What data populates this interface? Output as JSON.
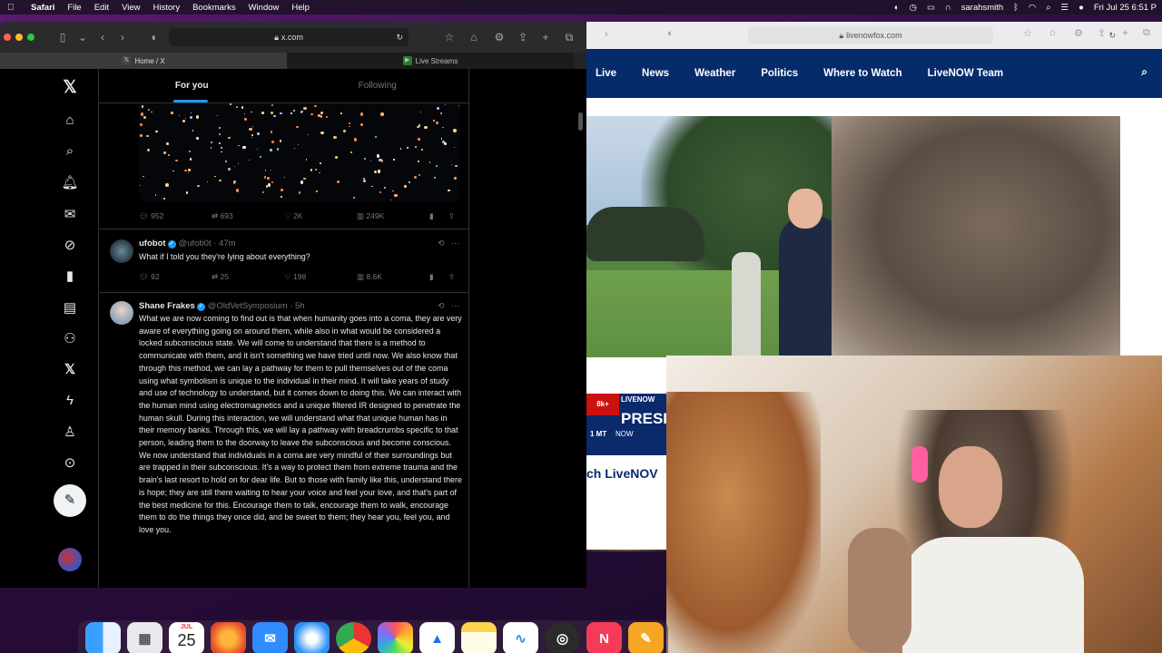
{
  "menubar": {
    "app": "Safari",
    "items": [
      "File",
      "Edit",
      "View",
      "History",
      "Bookmarks",
      "Window",
      "Help"
    ],
    "user": "sarahsmith",
    "datetime": "Fri Jul 25  6:51 P"
  },
  "left_window": {
    "url": "x.com",
    "tabs": [
      {
        "label": "Home / X",
        "active": true
      },
      {
        "label": "Live Streams",
        "active": false
      }
    ]
  },
  "x_nav": {
    "icons": [
      "x-logo-icon",
      "home-icon",
      "search-icon",
      "notifications-icon",
      "messages-icon",
      "grok-icon",
      "bookmarks-icon",
      "jobs-icon",
      "communities-icon",
      "premium-icon",
      "verified-orgs-icon",
      "profile-icon",
      "more-icon"
    ]
  },
  "feed": {
    "tabs": [
      "For you",
      "Following"
    ],
    "first_post_actions": {
      "replies": "952",
      "reposts": "693",
      "likes": "2K",
      "views": "249K"
    },
    "posts": [
      {
        "name": "ufobot",
        "handle": "@ufob0t · 47m",
        "text": "What if I told you they're lying about everything?",
        "replies": "92",
        "reposts": "25",
        "likes": "198",
        "views": "8.6K"
      },
      {
        "name": "Shane Frakes",
        "handle": "@OldVetSymposium · 5h",
        "text": "What we are now coming to find out is that when humanity goes into a coma, they are very aware of everything going on around them, while also in what would be considered a locked subconscious state. We will come to understand that there is a method to communicate with them, and it isn't something we have tried until now.  We also know that through this method, we can lay a pathway for them to pull themselves out of the coma using what symbolism is unique to the individual in their mind.  It will take years of study and use of technology to understand, but it comes down to doing this.  We can interact with the human mind using electromagnetics and a unique filtered IR designed to penetrate the human skull. During this interaction, we will understand what that unique human has in their memory banks.  Through this, we will lay a pathway with breadcrumbs specific to that person, leading them to the doorway to leave the subconscious and become conscious.  We now understand that individuals in a coma are very mindful of their surroundings but are trapped in their subconscious.  It's a way to protect them from extreme trauma and the brain's last resort to hold on for dear life.  But to those with family like this, understand there is hope; they are still there waiting to hear your voice and feel your love, and that's part of the best medicine for this.  Encourage them to talk, encourage them to walk, encourage them to do the things they once did, and be sweet to them; they hear you, feel you, and love you."
      }
    ]
  },
  "right_window": {
    "url": "livenowfox.com",
    "nav": [
      "Live",
      "News",
      "Weather",
      "Politics",
      "Where to Watch",
      "LiveNOW Team"
    ],
    "ticker": {
      "red": "8k+",
      "live": "LIVENOW",
      "pres": "PRESID",
      "mt": "1 MT",
      "now": "NOW"
    },
    "watch_text": "ch LiveNOV"
  },
  "dock": {
    "calendar_month": "JUL",
    "calendar_day": "25",
    "apps": [
      "finder-icon",
      "launchpad-icon",
      "calendar-icon",
      "firefox-icon",
      "mail-icon",
      "safari-icon",
      "chrome-icon",
      "photos-icon",
      "drive-icon",
      "notes-icon",
      "freeform-icon",
      "obs-icon",
      "news-icon",
      "pages-icon"
    ]
  }
}
